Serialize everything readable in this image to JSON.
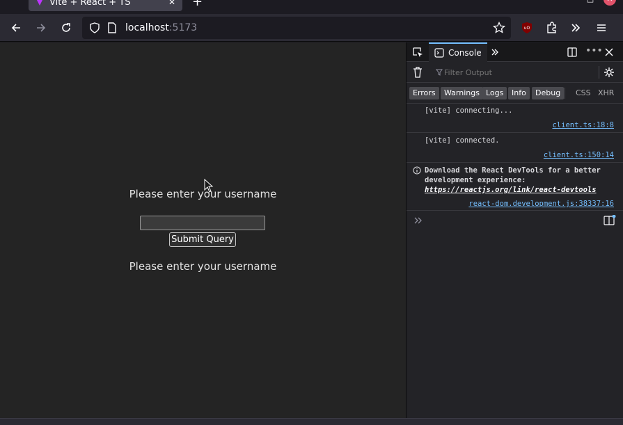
{
  "browser": {
    "tab_title": "Vite + React + TS",
    "url_host": "localhost",
    "url_port": ":5173"
  },
  "page": {
    "prompt_top": "Please enter your username",
    "input_value": "",
    "submit_label": "Submit Query",
    "prompt_bottom": "Please enter your username"
  },
  "devtools": {
    "active_tab": "Console",
    "filter_placeholder": "Filter Output",
    "levels": [
      "Errors",
      "Warnings",
      "Logs",
      "Info",
      "Debug"
    ],
    "extra_filters": [
      "CSS",
      "XHR"
    ],
    "messages": [
      {
        "text": "[vite] connecting...",
        "source": "client.ts:18:8"
      },
      {
        "text": "[vite] connected.",
        "source": "client.ts:150:14"
      },
      {
        "text_bold": "Download the React DevTools for a better development experience: ",
        "link": "https://reactjs.org/link/react-devtools",
        "source": "react-dom.development.js:38337:16"
      }
    ]
  },
  "colors": {
    "accent": "#75bfff",
    "page_bg": "#242424",
    "toolbar_bg": "#2b2a33"
  }
}
